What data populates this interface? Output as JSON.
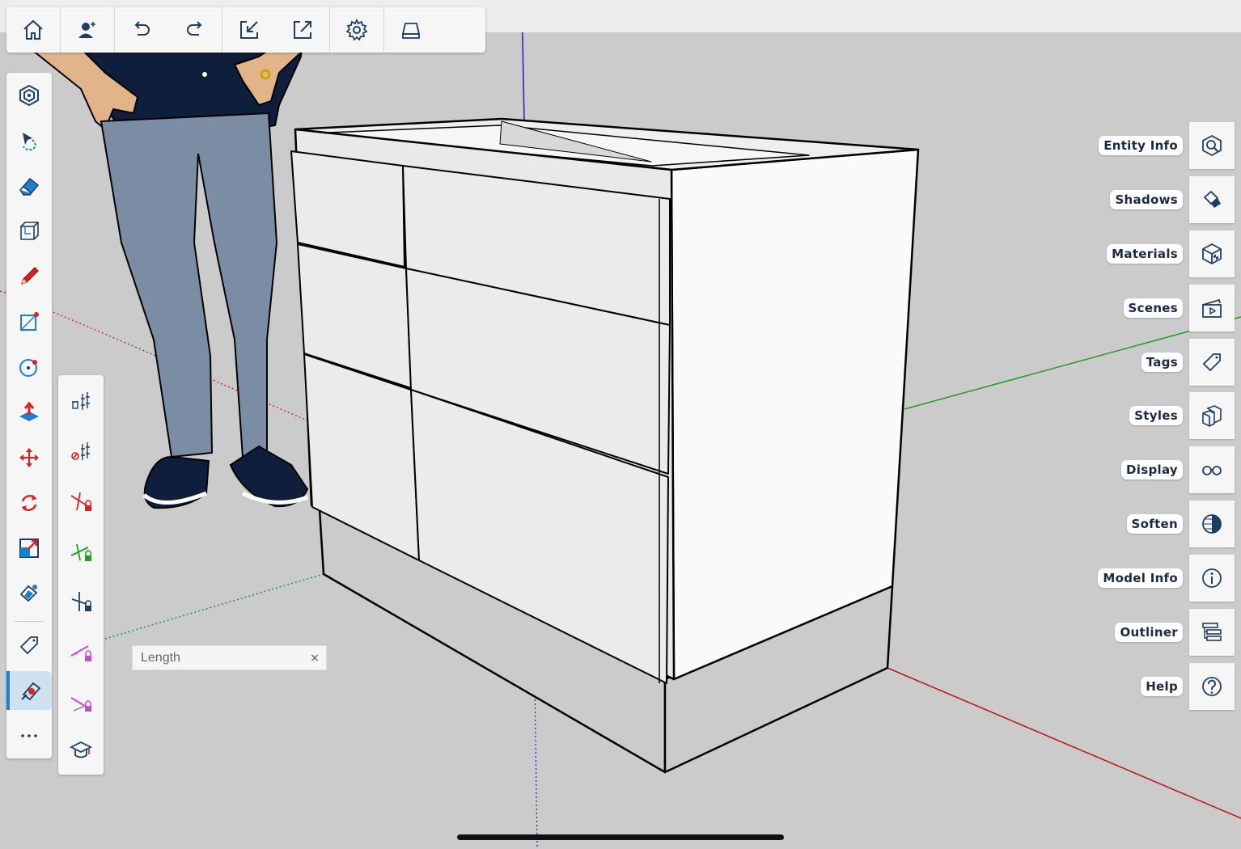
{
  "colors": {
    "accent": "#1d7fd0",
    "icon": "#1d3f66",
    "red": "#e02020",
    "green_axis": "#1aa01a",
    "blue_axis": "#2020c0",
    "red_axis": "#c01010"
  },
  "toolbar": {
    "buttons": [
      {
        "name": "home-icon"
      },
      {
        "name": "add-person-icon"
      },
      {
        "name": "undo-icon"
      },
      {
        "name": "redo-icon"
      },
      {
        "name": "import-icon"
      },
      {
        "name": "export-icon"
      },
      {
        "name": "settings-icon"
      },
      {
        "name": "drive-icon"
      }
    ]
  },
  "left_tools": [
    {
      "name": "orbit-icon"
    },
    {
      "name": "select-icon"
    },
    {
      "name": "eraser-icon"
    },
    {
      "name": "components-icon"
    },
    {
      "name": "pencil-icon"
    },
    {
      "name": "rectangle-icon"
    },
    {
      "name": "circle-icon"
    },
    {
      "name": "push-pull-icon"
    },
    {
      "name": "move-icon"
    },
    {
      "name": "rotate-icon"
    },
    {
      "name": "scale-icon"
    },
    {
      "name": "paint-bucket-icon"
    },
    {
      "name": "tag-icon"
    },
    {
      "name": "tape-measure-icon",
      "active": true
    },
    {
      "name": "more-icon"
    }
  ],
  "sub_tools": [
    {
      "name": "delete-guides-icon"
    },
    {
      "name": "hide-guides-icon"
    },
    {
      "name": "lock-red-axis-icon"
    },
    {
      "name": "lock-green-axis-icon"
    },
    {
      "name": "lock-blue-axis-icon"
    },
    {
      "name": "lock-magenta-icon"
    },
    {
      "name": "lock-inference-icon"
    },
    {
      "name": "learn-icon"
    }
  ],
  "vcb": {
    "label": "Length",
    "close": "×"
  },
  "tray": [
    {
      "label": "Entity Info",
      "icon": "entity-info-icon"
    },
    {
      "label": "Shadows",
      "icon": "shadows-icon"
    },
    {
      "label": "Materials",
      "icon": "materials-icon"
    },
    {
      "label": "Scenes",
      "icon": "scenes-icon"
    },
    {
      "label": "Tags",
      "icon": "tags-icon"
    },
    {
      "label": "Styles",
      "icon": "styles-icon"
    },
    {
      "label": "Display",
      "icon": "display-icon"
    },
    {
      "label": "Soften",
      "icon": "soften-icon"
    },
    {
      "label": "Model Info",
      "icon": "model-info-icon"
    },
    {
      "label": "Outliner",
      "icon": "outliner-icon"
    },
    {
      "label": "Help",
      "icon": "help-icon"
    }
  ]
}
